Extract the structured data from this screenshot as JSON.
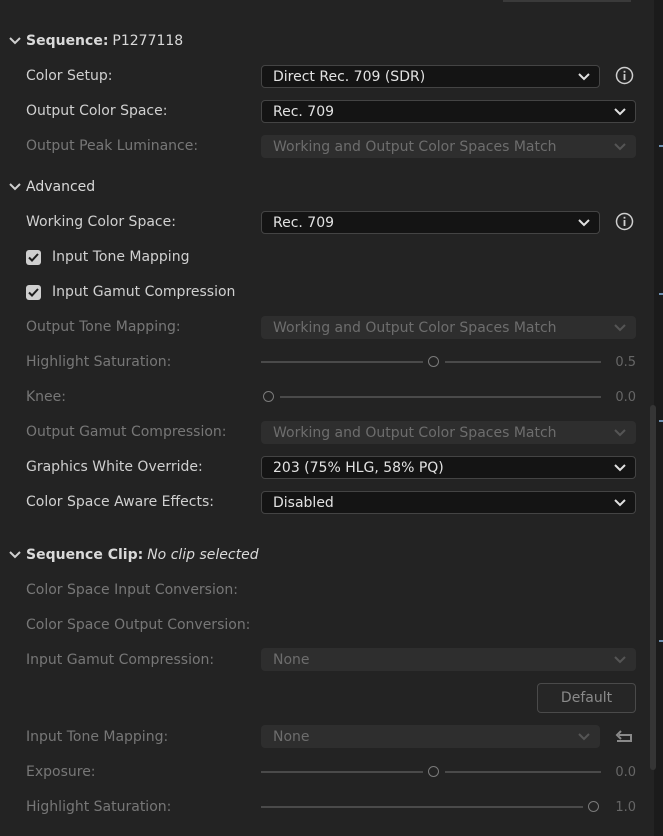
{
  "sequence": {
    "heading": "Sequence:",
    "name": "P1277118",
    "color_setup": {
      "label": "Color Setup:",
      "value": "Direct Rec. 709 (SDR)"
    },
    "output_color_space": {
      "label": "Output Color Space:",
      "value": "Rec. 709"
    },
    "output_peak_luminance": {
      "label": "Output Peak Luminance:",
      "value": "Working and Output Color Spaces Match"
    }
  },
  "advanced": {
    "heading": "Advanced",
    "working_color_space": {
      "label": "Working Color Space:",
      "value": "Rec. 709"
    },
    "input_tone_mapping": {
      "label": "Input Tone Mapping",
      "checked": true
    },
    "input_gamut_compression": {
      "label": "Input Gamut Compression",
      "checked": true
    },
    "output_tone_mapping": {
      "label": "Output Tone Mapping:",
      "value": "Working and Output Color Spaces Match"
    },
    "highlight_saturation": {
      "label": "Highlight Saturation:",
      "value": "0.5",
      "level": 0.5
    },
    "knee": {
      "label": "Knee:",
      "value": "0.0",
      "level": 0.0
    },
    "output_gamut_compression": {
      "label": "Output Gamut Compression:",
      "value": "Working and Output Color Spaces Match"
    },
    "graphics_white_override": {
      "label": "Graphics White Override:",
      "value": "203 (75% HLG, 58% PQ)"
    },
    "color_space_aware_effects": {
      "label": "Color Space Aware Effects:",
      "value": "Disabled"
    }
  },
  "sequence_clip": {
    "heading": "Sequence Clip:",
    "status": "No clip selected",
    "input_conversion": {
      "label": "Color Space Input Conversion:"
    },
    "output_conversion": {
      "label": "Color Space Output Conversion:"
    },
    "input_gamut_compression": {
      "label": "Input Gamut Compression:",
      "value": "None"
    },
    "default_button": "Default",
    "input_tone_mapping": {
      "label": "Input Tone Mapping:",
      "value": "None"
    },
    "exposure": {
      "label": "Exposure:",
      "value": "0.0",
      "level": 0.5
    },
    "highlight_saturation": {
      "label": "Highlight Saturation:",
      "value": "1.0",
      "level": 1.0
    }
  },
  "icons": {
    "chevron": "chevron-down-icon",
    "info": "info-icon",
    "check": "checkmark-icon",
    "reset": "reset-icon"
  },
  "colors": {
    "background": "#232323",
    "field_active": "#141414",
    "field_disabled": "#2e2e2e",
    "text": "#d0d0d0",
    "text_dim": "#777777"
  }
}
